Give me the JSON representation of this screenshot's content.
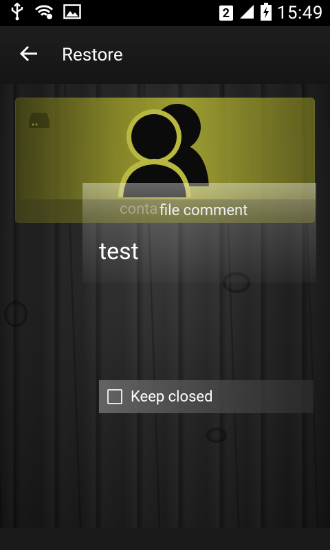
{
  "status_bar": {
    "time": "15:49",
    "sim_slot": "2",
    "icons": [
      "usb-icon",
      "wifi-icon",
      "image-notification-icon",
      "signal-icon",
      "battery-charging-icon"
    ]
  },
  "app_bar": {
    "title": "Restore",
    "back_icon": "arrow-left-icon"
  },
  "background_card": {
    "label": "conta",
    "icons": [
      "drive-icon",
      "contacts-icon"
    ],
    "accent_color": "#b8b840"
  },
  "dialog": {
    "title": "file comment",
    "body": "test"
  },
  "keep_closed": {
    "label": "Keep closed",
    "checked": false
  }
}
